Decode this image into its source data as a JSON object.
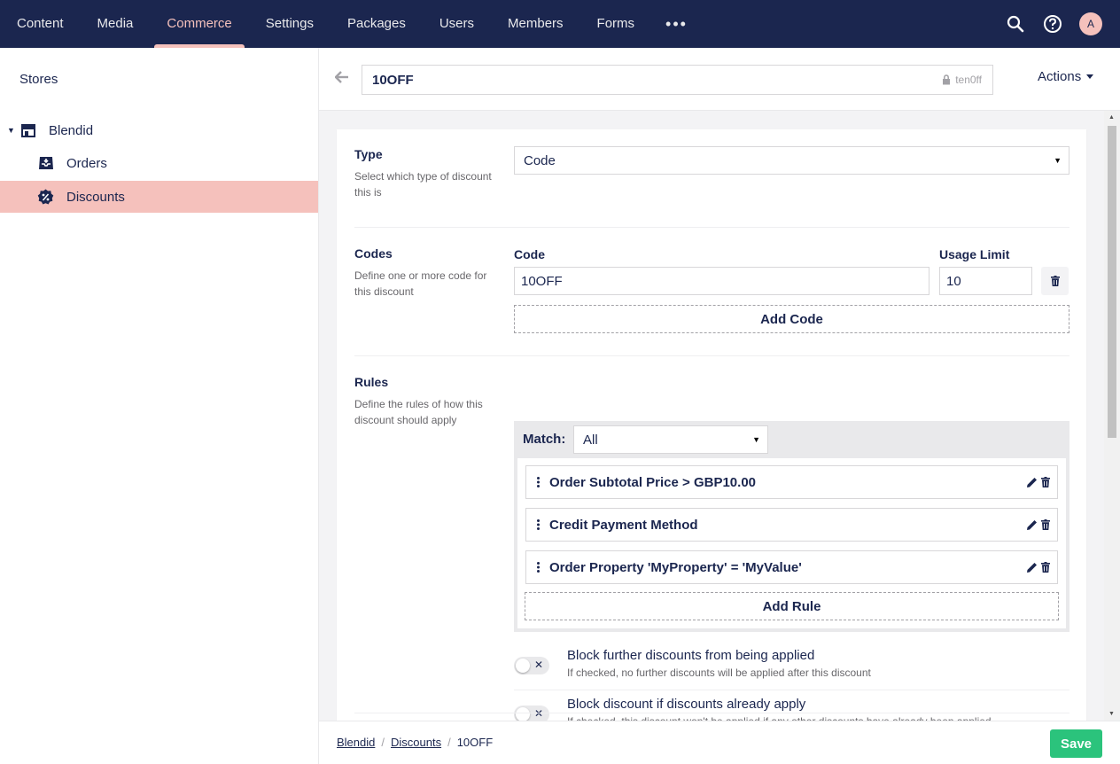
{
  "nav": {
    "items": [
      {
        "label": "Content"
      },
      {
        "label": "Media"
      },
      {
        "label": "Commerce",
        "active": true
      },
      {
        "label": "Settings"
      },
      {
        "label": "Packages"
      },
      {
        "label": "Users"
      },
      {
        "label": "Members"
      },
      {
        "label": "Forms"
      }
    ],
    "more": "•••",
    "avatar_initial": "A"
  },
  "sidebar": {
    "title": "Stores",
    "store": "Blendid",
    "items": [
      {
        "label": "Orders",
        "icon": "inbox-icon"
      },
      {
        "label": "Discounts",
        "icon": "discount-badge-icon",
        "selected": true
      }
    ]
  },
  "header": {
    "name": "10OFF",
    "alias": "ten0ff",
    "actions_label": "Actions"
  },
  "type": {
    "label": "Type",
    "description": "Select which type of discount this is",
    "value": "Code"
  },
  "codes": {
    "label": "Codes",
    "description": "Define one or more code for this discount",
    "code_header": "Code",
    "usage_header": "Usage Limit",
    "code_value": "10OFF",
    "usage_value": "10",
    "add_label": "Add Code"
  },
  "rules": {
    "label": "Rules",
    "description": "Define the rules of how this discount should apply",
    "match_label": "Match:",
    "match_value": "All",
    "items": [
      {
        "label": "Order Subtotal Price > GBP10.00"
      },
      {
        "label": "Credit Payment Method"
      },
      {
        "label": "Order Property 'MyProperty' = 'MyValue'"
      }
    ],
    "add_label": "Add Rule"
  },
  "toggles": [
    {
      "title": "Block further discounts from being applied",
      "description": "If checked, no further discounts will be applied after this discount",
      "checked": false
    },
    {
      "title": "Block discount if discounts already apply",
      "description": "If checked, this discount won't be applied if any other discounts have already been applied",
      "checked": false
    }
  ],
  "footer": {
    "breadcrumb": [
      "Blendid",
      "Discounts",
      "10OFF"
    ],
    "separator": "/",
    "save_label": "Save"
  },
  "colors": {
    "nav_bg": "#1b264f",
    "accent": "#f5c1bc",
    "save": "#2bc37c"
  }
}
